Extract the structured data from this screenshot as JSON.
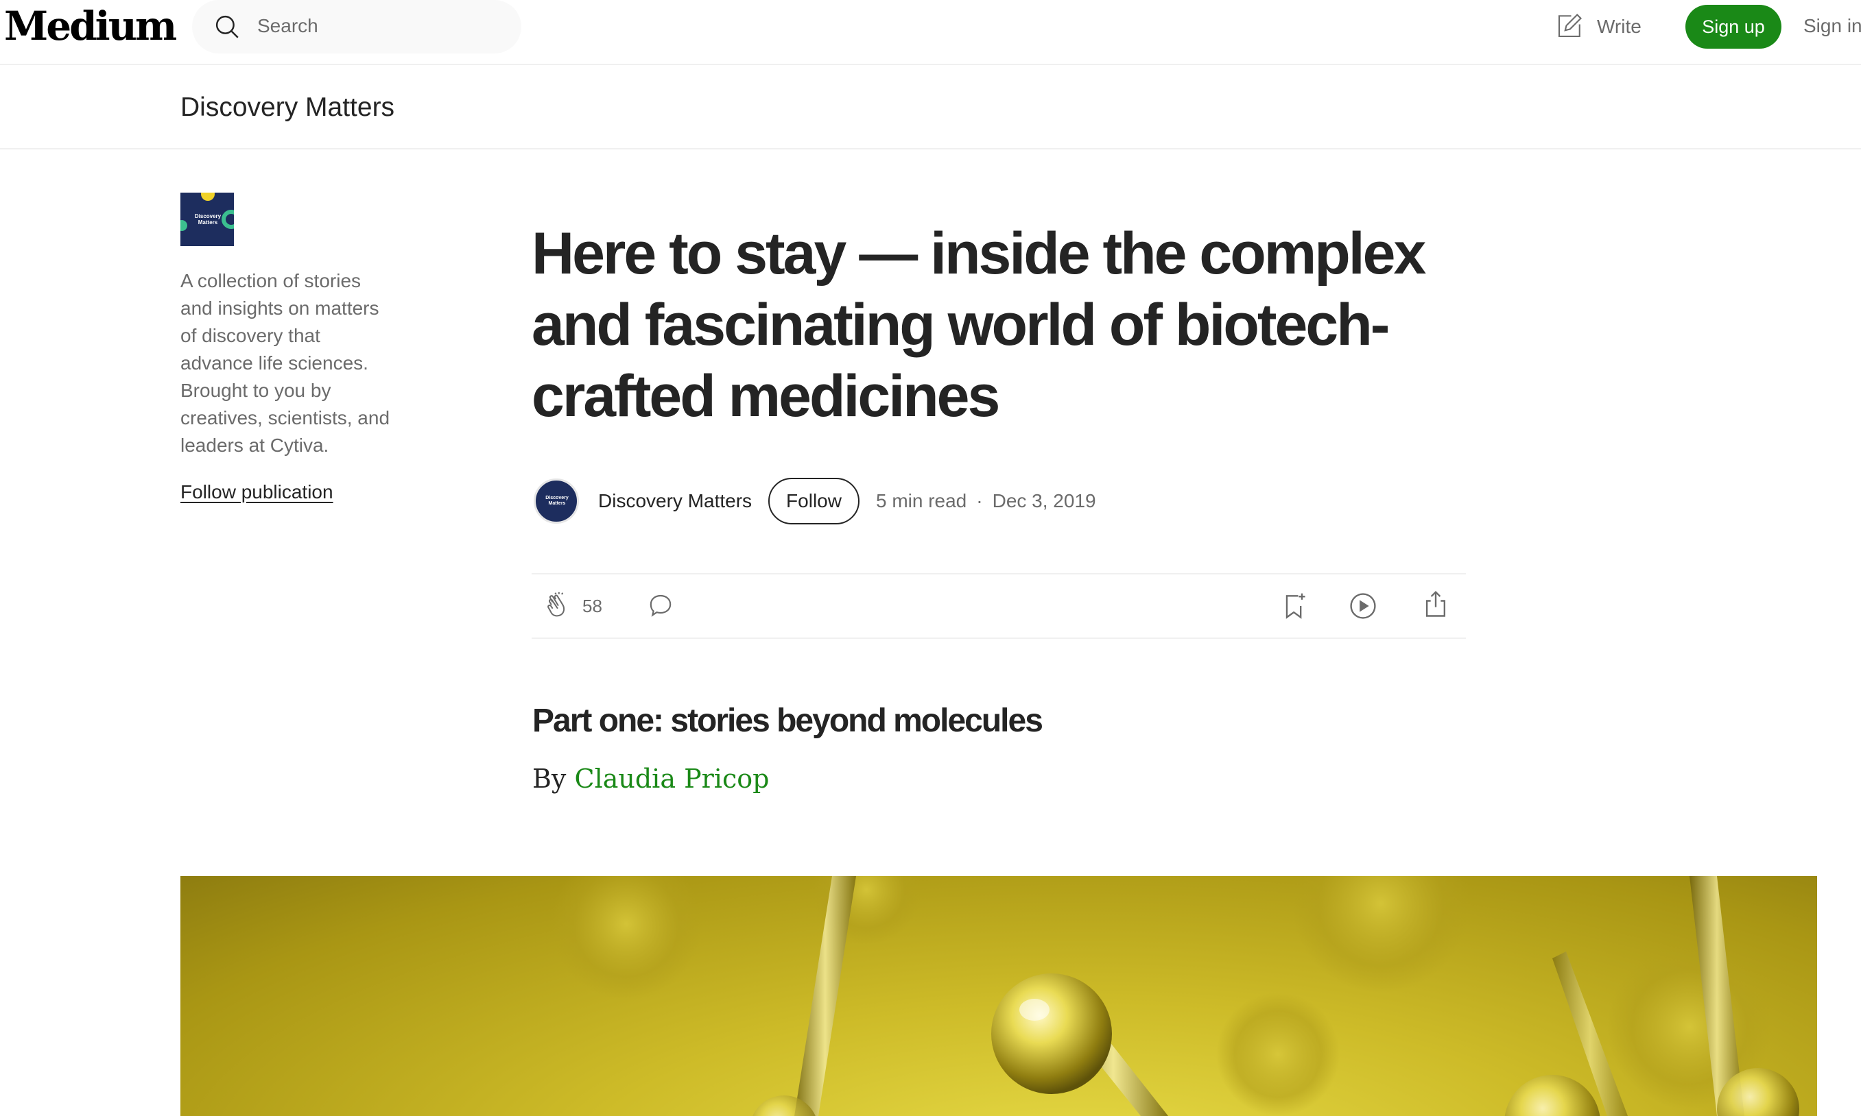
{
  "nav": {
    "logo": "Medium",
    "search_placeholder": "Search",
    "write_label": "Write",
    "signup_label": "Sign up",
    "signin_label": "Sign in"
  },
  "publication": {
    "name": "Discovery Matters",
    "logo_text": "Discovery Matters",
    "description": "A collection of stories and insights on matters of discovery that advance life sciences. Brought to you by creatives, scientists, and leaders at Cytiva.",
    "follow_label": "Follow publication"
  },
  "article": {
    "title": "Here to stay — inside the complex and fascinating world of biotech-crafted medicines",
    "author": "Discovery Matters",
    "follow_label": "Follow",
    "read_time": "5 min read",
    "separator": "·",
    "date": "Dec 3, 2019",
    "clap_count": "58",
    "subtitle": "Part one: stories beyond molecules",
    "by_prefix": "By",
    "byline_author": "Claudia Pricop"
  },
  "colors": {
    "brand_green": "#1a8917",
    "text_dark": "#242424",
    "text_muted": "#6b6b6b",
    "publication_navy": "#1d2d5e"
  },
  "icons": {
    "search": "search-icon",
    "write": "pencil-square-icon",
    "clap": "clap-icon",
    "response": "speech-bubble-icon",
    "save": "bookmark-plus-icon",
    "listen": "play-circle-icon",
    "share": "share-icon"
  }
}
